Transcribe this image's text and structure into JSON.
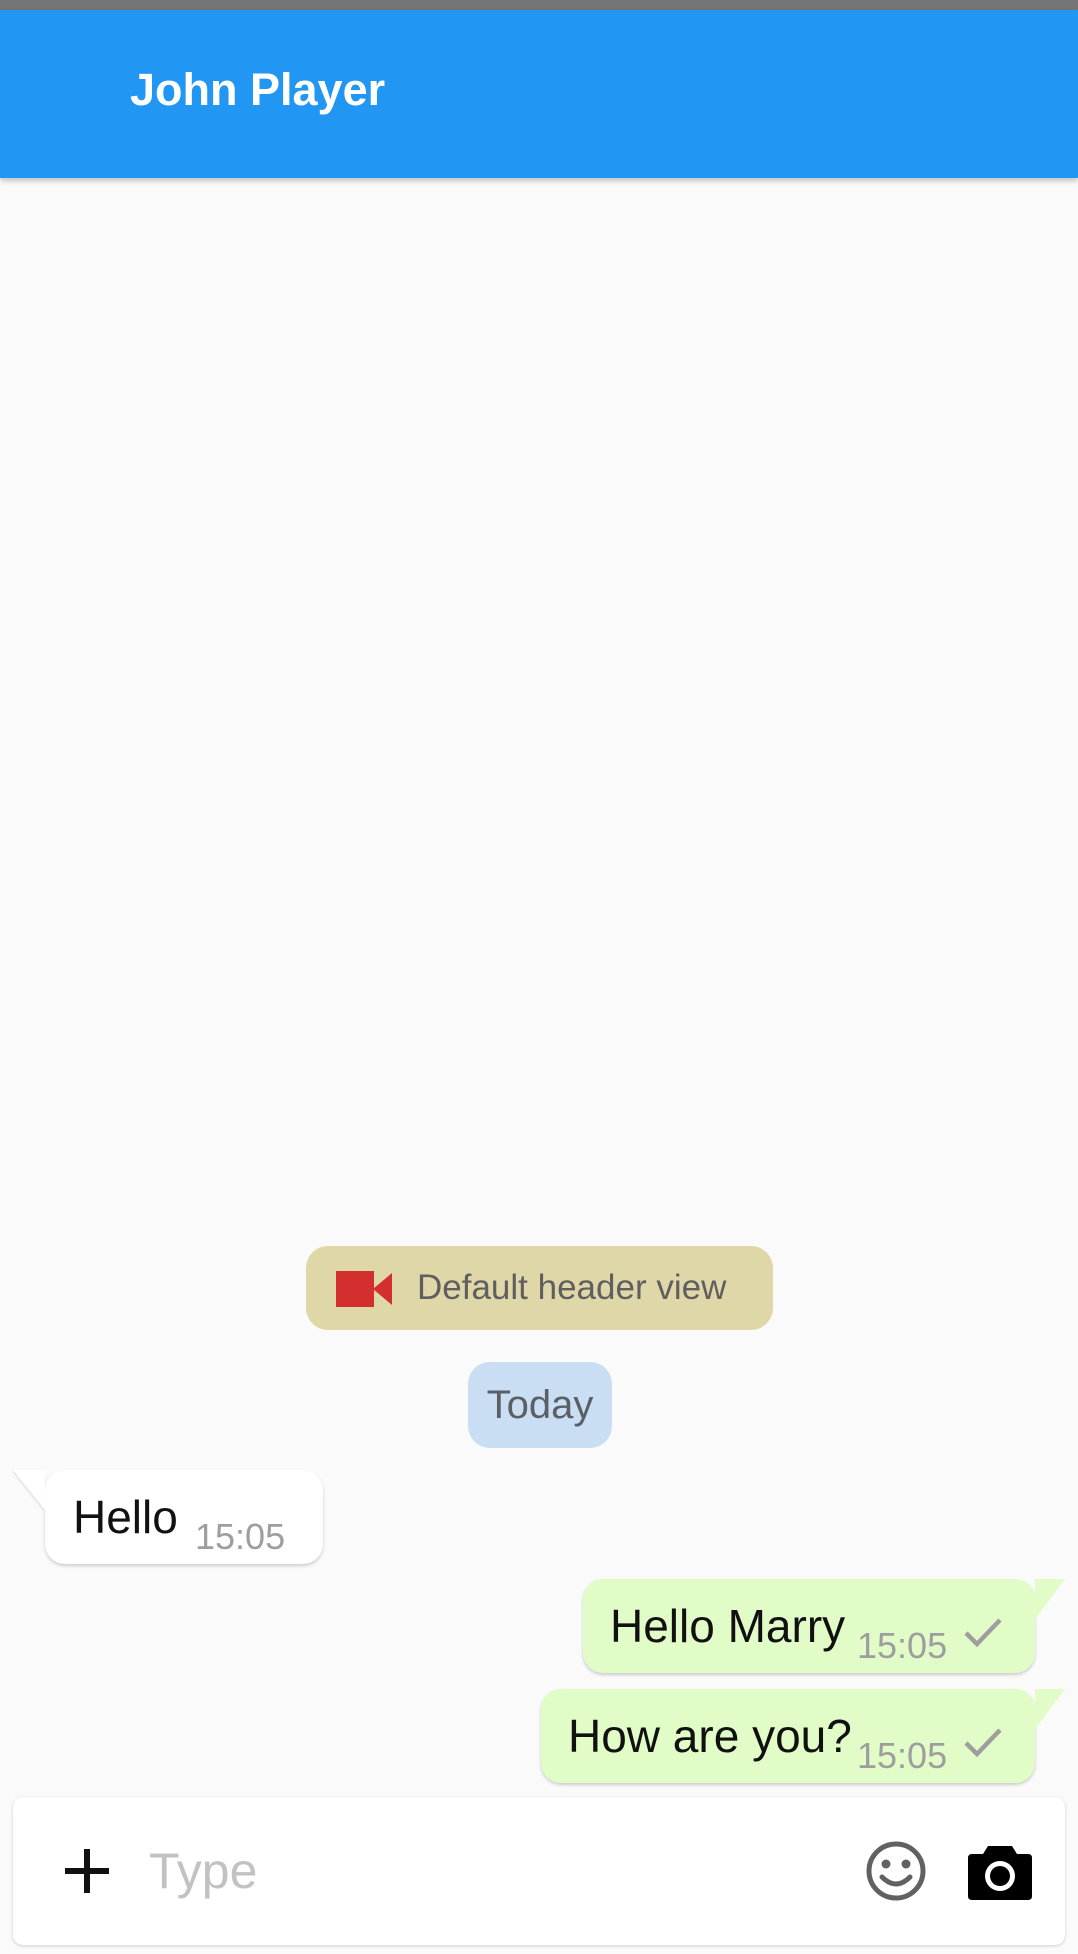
{
  "app_bar": {
    "title": "John Player"
  },
  "chat": {
    "header_view": {
      "icon": "video-camera-icon",
      "icon_color": "#d32f2f",
      "label": "Default header view"
    },
    "date_divider": "Today",
    "messages": [
      {
        "direction": "incoming",
        "text": "Hello",
        "time": "15:05"
      },
      {
        "direction": "outgoing",
        "text": "Hello Marry",
        "time": "15:05",
        "status_icon": "check-icon"
      },
      {
        "direction": "outgoing",
        "text": "How are you?",
        "time": "15:05",
        "status_icon": "check-icon"
      }
    ]
  },
  "composer": {
    "add_icon": "plus-icon",
    "placeholder": "Type",
    "emoji_icon": "smiley-icon",
    "camera_icon": "camera-icon"
  },
  "colors": {
    "app_bar": "#2196f3",
    "status_bar": "#757575",
    "header_chip": "#e0d7a8",
    "date_chip": "#c9def2",
    "incoming_bubble": "#ffffff",
    "outgoing_bubble": "#e2fcc7"
  }
}
